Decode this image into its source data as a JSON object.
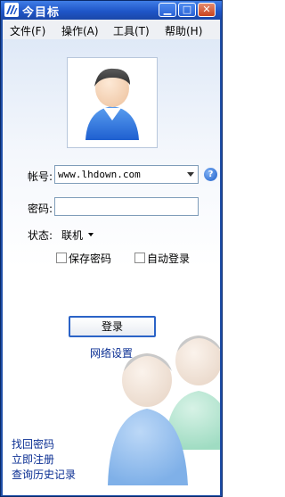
{
  "window": {
    "title": "今目标",
    "minimize_symbol": "▁",
    "maximize_symbol": "□",
    "close_symbol": "✕"
  },
  "menu": {
    "items": [
      {
        "label": "文件(F)"
      },
      {
        "label": "操作(A)"
      },
      {
        "label": "工具(T)"
      },
      {
        "label": "帮助(H)"
      }
    ]
  },
  "login": {
    "account_label": "帐号:",
    "account_value": "www.lhdown.com",
    "help_symbol": "?",
    "password_label": "密码:",
    "password_value": "",
    "status_label": "状态:",
    "status_value": "联机",
    "save_password_label": "保存密码",
    "save_password_checked": false,
    "auto_login_label": "自动登录",
    "auto_login_checked": false,
    "login_button": "登录",
    "network_settings": "网络设置"
  },
  "links": {
    "retrieve_password": "找回密码",
    "register": "立即注册",
    "history": "查询历史记录"
  },
  "colors": {
    "titlebar": "#1f56c8",
    "link": "#0b2f93",
    "button_border": "#2b63c7"
  }
}
